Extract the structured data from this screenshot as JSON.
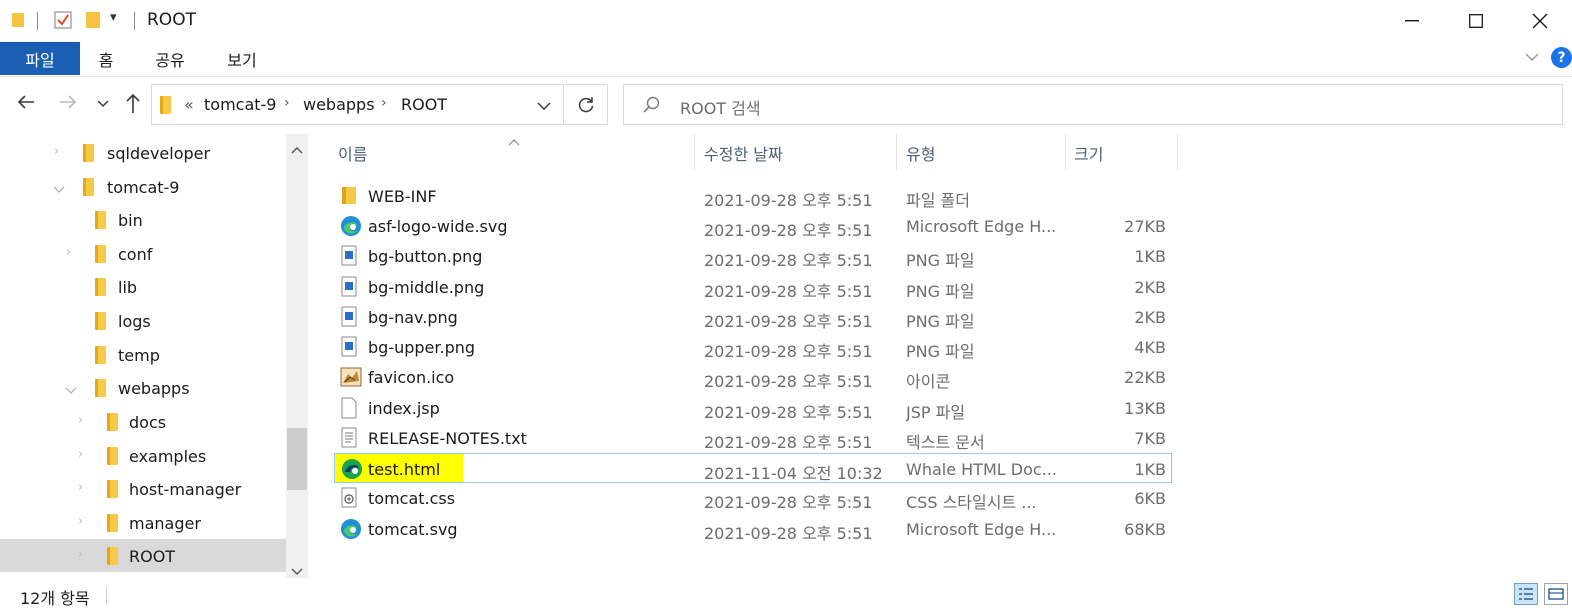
{
  "window": {
    "title": "ROOT"
  },
  "ribbon": {
    "tabs": [
      {
        "label": "파일"
      },
      {
        "label": "홈"
      },
      {
        "label": "공유"
      },
      {
        "label": "보기"
      }
    ]
  },
  "address": {
    "overflow": "«",
    "crumbs": [
      "tomcat-9",
      "webapps",
      "ROOT"
    ]
  },
  "search": {
    "placeholder": "ROOT 검색"
  },
  "tree": {
    "items": [
      {
        "label": "sqldeveloper",
        "level": 0,
        "expanded": false,
        "selected": false
      },
      {
        "label": "tomcat-9",
        "level": 0,
        "expanded": true,
        "selected": false
      },
      {
        "label": "bin",
        "level": 1,
        "expanded": false,
        "selected": false
      },
      {
        "label": "conf",
        "level": 1,
        "expanded": false,
        "selected": false
      },
      {
        "label": "lib",
        "level": 1,
        "expanded": false,
        "selected": false
      },
      {
        "label": "logs",
        "level": 1,
        "expanded": false,
        "selected": false
      },
      {
        "label": "temp",
        "level": 1,
        "expanded": false,
        "selected": false
      },
      {
        "label": "webapps",
        "level": 1,
        "expanded": true,
        "selected": false
      },
      {
        "label": "docs",
        "level": 2,
        "expanded": false,
        "selected": false
      },
      {
        "label": "examples",
        "level": 2,
        "expanded": false,
        "selected": false
      },
      {
        "label": "host-manager",
        "level": 2,
        "expanded": false,
        "selected": false
      },
      {
        "label": "manager",
        "level": 2,
        "expanded": false,
        "selected": false
      },
      {
        "label": "ROOT",
        "level": 2,
        "expanded": false,
        "selected": true
      }
    ]
  },
  "columns": {
    "name": "이름",
    "modified": "수정한 날짜",
    "type": "유형",
    "size": "크기"
  },
  "files": [
    {
      "name": "WEB-INF",
      "modified": "2021-09-28 오후 5:51",
      "type": "파일 폴더",
      "size": "",
      "icon": "folder-icon"
    },
    {
      "name": "asf-logo-wide.svg",
      "modified": "2021-09-28 오후 5:51",
      "type": "Microsoft Edge H...",
      "size": "27KB",
      "icon": "edge-icon"
    },
    {
      "name": "bg-button.png",
      "modified": "2021-09-28 오후 5:51",
      "type": "PNG 파일",
      "size": "1KB",
      "icon": "image-file-icon"
    },
    {
      "name": "bg-middle.png",
      "modified": "2021-09-28 오후 5:51",
      "type": "PNG 파일",
      "size": "2KB",
      "icon": "image-file-icon"
    },
    {
      "name": "bg-nav.png",
      "modified": "2021-09-28 오후 5:51",
      "type": "PNG 파일",
      "size": "2KB",
      "icon": "image-file-icon"
    },
    {
      "name": "bg-upper.png",
      "modified": "2021-09-28 오후 5:51",
      "type": "PNG 파일",
      "size": "4KB",
      "icon": "image-file-icon"
    },
    {
      "name": "favicon.ico",
      "modified": "2021-09-28 오후 5:51",
      "type": "아이콘",
      "size": "22KB",
      "icon": "tomcat-favicon-icon"
    },
    {
      "name": "index.jsp",
      "modified": "2021-09-28 오후 5:51",
      "type": "JSP 파일",
      "size": "13KB",
      "icon": "blank-file-icon"
    },
    {
      "name": "RELEASE-NOTES.txt",
      "modified": "2021-09-28 오후 5:51",
      "type": "텍스트 문서",
      "size": "7KB",
      "icon": "text-file-icon"
    },
    {
      "name": "test.html",
      "modified": "2021-11-04 오전 10:32",
      "type": "Whale HTML Doc...",
      "size": "1KB",
      "icon": "whale-icon",
      "highlighted": true
    },
    {
      "name": "tomcat.css",
      "modified": "2021-09-28 오후 5:51",
      "type": "CSS 스타일시트 ...",
      "size": "6KB",
      "icon": "css-file-icon"
    },
    {
      "name": "tomcat.svg",
      "modified": "2021-09-28 오후 5:51",
      "type": "Microsoft Edge H...",
      "size": "68KB",
      "icon": "edge-icon"
    }
  ],
  "status": {
    "item_count": "12개 항목"
  },
  "colors": {
    "ribbon_file_tab": "#1a5fb4",
    "selected_tree_row": "#d9d9d9",
    "highlighter": "#ffff00",
    "row_highlight_border": "#99c9ef",
    "help_button": "#1a73e8"
  }
}
